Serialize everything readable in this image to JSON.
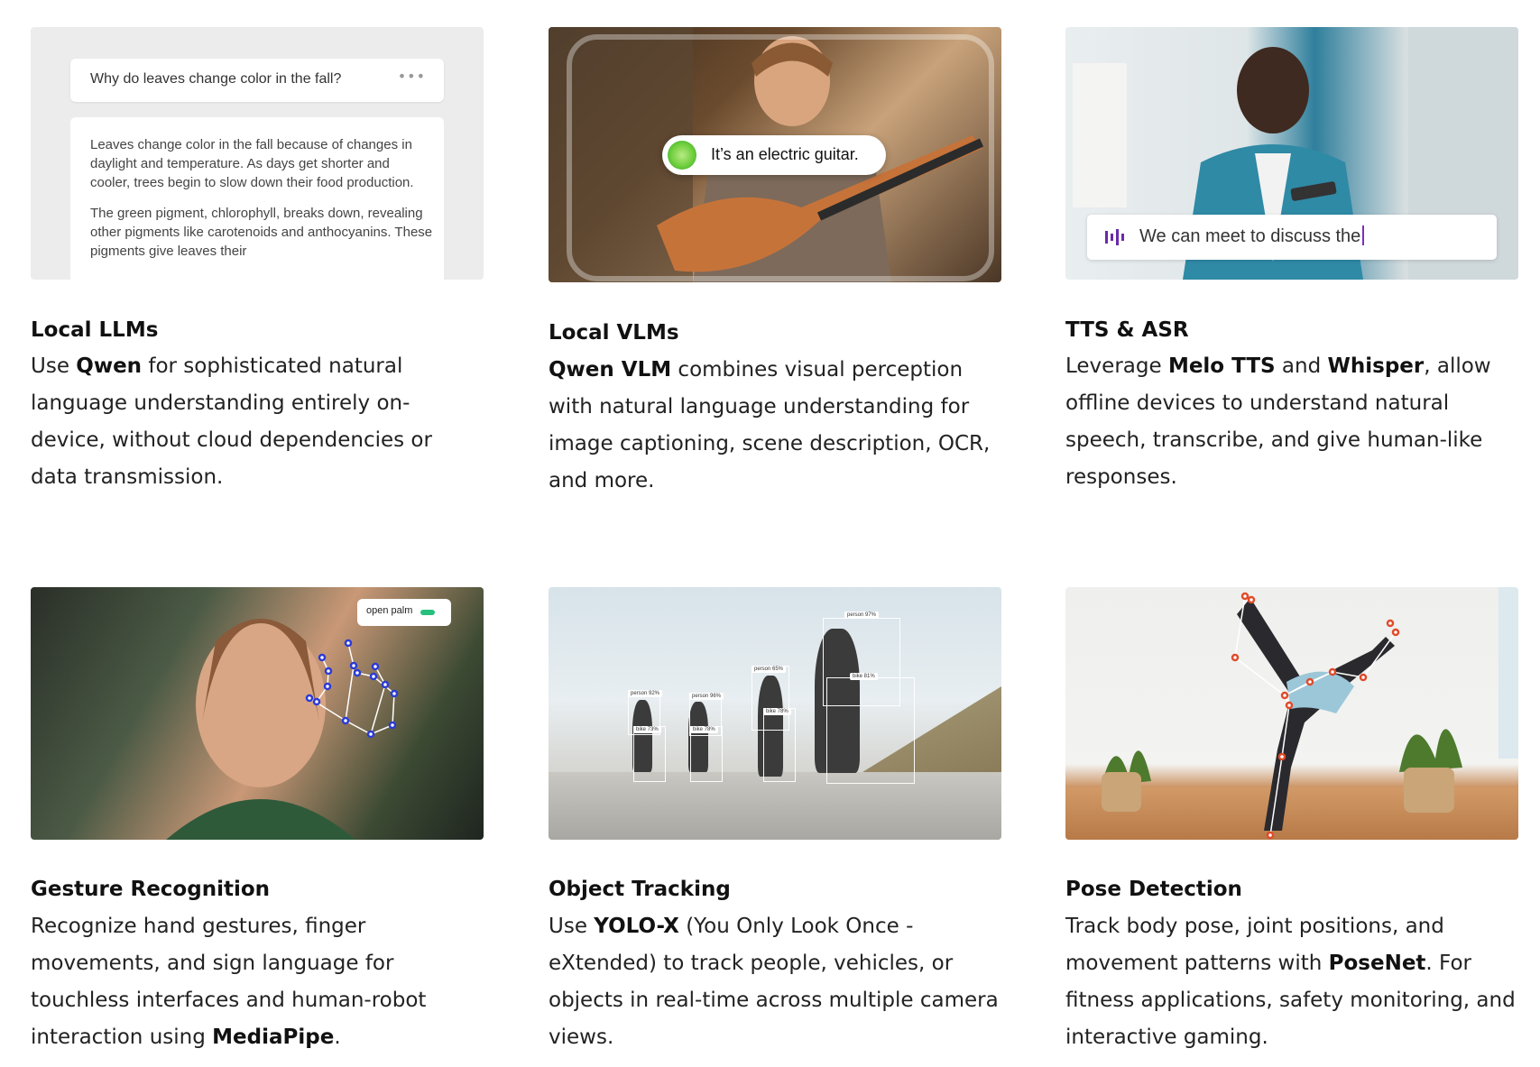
{
  "cards": [
    {
      "title": "Local LLMs",
      "desc": [
        {
          "t": "Use "
        },
        {
          "t": "Qwen",
          "b": true
        },
        {
          "t": " for sophisticated natural language understanding entirely on-device, without cloud dependencies or data transmission."
        }
      ],
      "chat": {
        "question": "Why do leaves change color in the fall?",
        "menu": "•••",
        "answer_p1": "Leaves change color in the fall because of changes in daylight and temperature. As days get shorter and cooler, trees begin to slow down their food production.",
        "answer_p2": "The green pigment, chlorophyll, breaks down, revealing other pigments like carotenoids and anthocyanins. These pigments give leaves their"
      }
    },
    {
      "title": "Local VLMs",
      "desc": [
        {
          "t": "Qwen VLM",
          "b": true
        },
        {
          "t": " combines visual perception with natural language understanding for image captioning, scene description, OCR, and more."
        }
      ],
      "caption": "It’s an electric guitar."
    },
    {
      "title": "TTS & ASR",
      "desc": [
        {
          "t": "Leverage "
        },
        {
          "t": "Melo TTS",
          "b": true
        },
        {
          "t": " and "
        },
        {
          "t": "Whisper",
          "b": true
        },
        {
          "t": ", allow offline devices to understand natural speech, transcribe, and give human-like responses."
        }
      ],
      "transcript": "We can meet to discuss the"
    },
    {
      "title": "Gesture Recognition",
      "desc": [
        {
          "t": "Recognize hand gestures, finger movements, and sign language for touchless interfaces and human-robot interaction using "
        },
        {
          "t": "MediaPipe",
          "b": true
        },
        {
          "t": "."
        }
      ],
      "gesture_label": "open palm"
    },
    {
      "title": "Object Tracking",
      "desc": [
        {
          "t": "Use "
        },
        {
          "t": "YOLO-X",
          "b": true
        },
        {
          "t": " (You Only Look Once - eXtended) to track people, vehicles, or objects in real-time across multiple camera views."
        }
      ],
      "detections": [
        {
          "label": "person 92%"
        },
        {
          "label": "bike 73%"
        },
        {
          "label": "person 96%"
        },
        {
          "label": "bike 78%"
        },
        {
          "label": "person 65%"
        },
        {
          "label": "bike 78%"
        },
        {
          "label": "person 97%"
        },
        {
          "label": "bike 81%"
        }
      ]
    },
    {
      "title": "Pose Detection",
      "desc": [
        {
          "t": "Track body pose, joint positions, and movement patterns with "
        },
        {
          "t": "PoseNet",
          "b": true
        },
        {
          "t": ". For fitness applications, safety monitoring, and interactive gaming."
        }
      ]
    }
  ],
  "colors": {
    "accent_green": "#27c07d",
    "accent_purple": "#6b2aa8"
  }
}
